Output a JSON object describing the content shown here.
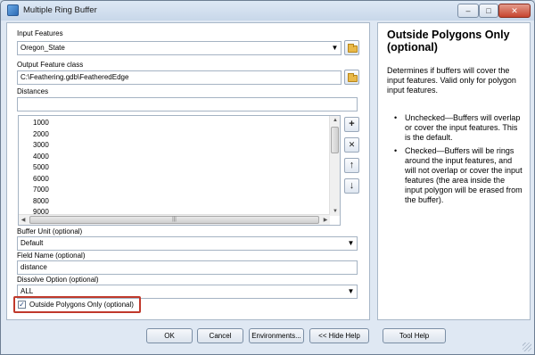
{
  "window": {
    "title": "Multiple Ring Buffer",
    "controls": {
      "minimize": "–",
      "maximize": "□",
      "close": "✕"
    }
  },
  "form": {
    "input_features": {
      "label": "Input Features",
      "value": "Oregon_State"
    },
    "output_feature_class": {
      "label": "Output Feature class",
      "value": "C:\\Feathering.gdb\\FeatheredEdge"
    },
    "distances": {
      "label": "Distances",
      "value": "",
      "items": [
        "1000",
        "2000",
        "3000",
        "4000",
        "5000",
        "6000",
        "7000",
        "8000",
        "9000"
      ]
    },
    "side_buttons": {
      "add": "+",
      "remove": "✕",
      "up": "↑",
      "down": "↓"
    },
    "scroll": {
      "up": "▲",
      "down": "▼",
      "left": "◀",
      "right": "▶",
      "grip": "|||"
    },
    "buffer_unit": {
      "label": "Buffer Unit (optional)",
      "value": "Default"
    },
    "field_name": {
      "label": "Field Name (optional)",
      "value": "distance"
    },
    "dissolve_option": {
      "label": "Dissolve Option (optional)",
      "value": "ALL"
    },
    "outside_polygons": {
      "label": "Outside Polygons Only (optional)",
      "checked": true,
      "mark": "✓"
    },
    "dropdown_arrow": "▼"
  },
  "help": {
    "title": "Outside Polygons Only (optional)",
    "description": "Determines if buffers will cover the input features. Valid only for polygon input features.",
    "bullet": "•",
    "items": [
      "Unchecked—Buffers will overlap or cover the input features. This is the default.",
      "Checked—Buffers will be rings around the input features, and will not overlap or cover the input features (the area inside the input polygon will be erased from the buffer)."
    ]
  },
  "buttons": {
    "ok": "OK",
    "cancel": "Cancel",
    "environments": "Environments...",
    "hide_help": "<< Hide Help",
    "tool_help": "Tool Help"
  },
  "colors": {
    "window_bg": "#dfe8f3",
    "highlight_border": "#c0392b",
    "close_button": "#c6452e"
  }
}
